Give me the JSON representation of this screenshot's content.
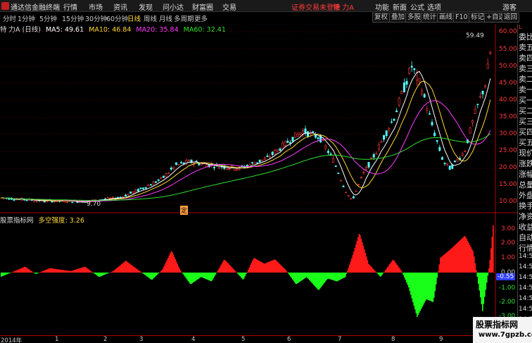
{
  "app": {
    "title": "通达信金融终端",
    "menus": [
      "行情",
      "市场",
      "资讯",
      "发现",
      "问小达",
      "财富圈",
      "交易"
    ],
    "login_status": "证券交易未登录",
    "stock_name": "特 力A",
    "right_menus": [
      "功能",
      "新面",
      "公式",
      "选项",
      "游客"
    ]
  },
  "toolbar": {
    "periods": [
      "分时",
      "1分钟",
      "5分钟",
      "15分钟",
      "30分钟",
      "60分钟",
      "日线",
      "周线",
      "月线",
      "多周期",
      "更多"
    ],
    "active_period": "日线",
    "buttons": [
      "复权",
      "叠加",
      "多股",
      "统计",
      "画线",
      "F10",
      "标记",
      "+自选",
      "返回"
    ]
  },
  "main_chart": {
    "title": "特 力A (日线)",
    "ma_labels": [
      {
        "label": "MA5: 49.61",
        "color": "#ffffff"
      },
      {
        "label": "MA10: 46.84",
        "color": "#ffd83a"
      },
      {
        "label": "MA20: 35.84",
        "color": "#ff3cff"
      },
      {
        "label": "MA60: 32.41",
        "color": "#30e030"
      }
    ],
    "price_axis": [
      "60.00",
      "55.00",
      "50.00",
      "45.00",
      "40.00",
      "35.00",
      "30.00",
      "25.00",
      "20.00",
      "15.00",
      "10.00"
    ],
    "high_label": "59.49",
    "low_label": "9.70",
    "marker": "定"
  },
  "indicator": {
    "title": "股票指标网",
    "name": "多空强度",
    "value": "3.26",
    "axis": [
      "3.00",
      "2.00",
      "1.00",
      "0.00",
      "-1.00",
      "-2.00",
      "-3.00"
    ],
    "current": "-0.55"
  },
  "right_panel": {
    "top_mark": "L",
    "items": [
      "委比",
      "卖五",
      "卖四",
      "卖三",
      "卖二",
      "卖一",
      "买一",
      "买二",
      "买三",
      "买四",
      "买五",
      "现价",
      "涨跌",
      "涨幅",
      "总量",
      "外盘",
      "换手",
      "净资",
      "收益",
      "自动",
      "行情",
      "14:56",
      "14:56",
      "14:56",
      "14:56",
      "14:56",
      "14:56",
      "14:56",
      "14:56",
      "14:56"
    ]
  },
  "time_axis": [
    "2014年",
    "1",
    "2",
    "3",
    "4",
    "5",
    "6",
    "7",
    "8",
    "9"
  ],
  "watermark": {
    "line1": "股票指标网",
    "line2": "www.7gpzb.com"
  }
}
